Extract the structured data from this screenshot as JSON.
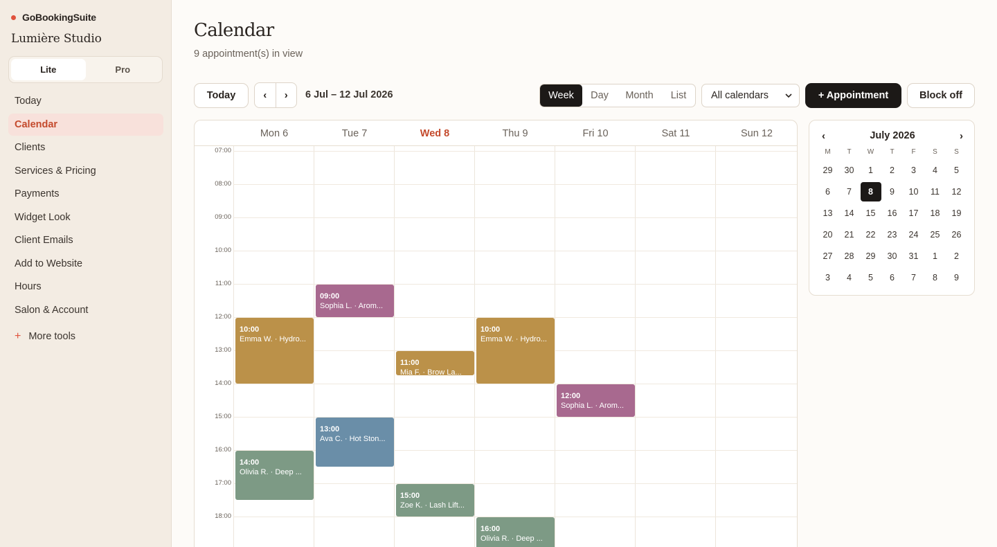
{
  "app": {
    "name": "GoBookingSuite",
    "salon": "Lumière Studio"
  },
  "plan_toggle": {
    "options": [
      "Lite",
      "Pro"
    ],
    "selected": "Lite"
  },
  "sidebar": {
    "items": [
      "Today",
      "Calendar",
      "Clients",
      "Services & Pricing",
      "Payments",
      "Widget Look",
      "Client Emails",
      "Add to Website",
      "Hours",
      "Salon & Account"
    ],
    "active": "Calendar",
    "more": {
      "icon": "+",
      "label": "More tools"
    }
  },
  "header": {
    "title": "Calendar",
    "subtitle": "9 appointment(s) in view"
  },
  "toolbar": {
    "today": "Today",
    "prev": "‹",
    "next": "›",
    "range": "6 Jul – 12 Jul 2026",
    "views": [
      "Week",
      "Day",
      "Month",
      "List"
    ],
    "active_view": "Week",
    "calendar_select": "All calendars",
    "add_appointment": "+ Appointment",
    "block_off": "Block off"
  },
  "week": {
    "days": [
      "Mon 6",
      "Tue 7",
      "Wed 8",
      "Thu 9",
      "Fri 10",
      "Sat 11",
      "Sun 12"
    ],
    "today_index": 2,
    "hours": [
      "07:00",
      "08:00",
      "09:00",
      "10:00",
      "11:00",
      "12:00",
      "13:00",
      "14:00",
      "15:00",
      "16:00",
      "17:00",
      "18:00"
    ]
  },
  "appointments": [
    {
      "day": 1,
      "start": 9,
      "duration": 1,
      "time": "09:00",
      "label": "Sophia L. · Arom...",
      "color": "#a8698f"
    },
    {
      "day": 0,
      "start": 10,
      "duration": 2,
      "time": "10:00",
      "label": "Emma W. · Hydro...",
      "color": "#bb9149"
    },
    {
      "day": 2,
      "start": 11,
      "duration": 0.75,
      "time": "11:00",
      "label": "Mia F. · Brow La...",
      "color": "#bb9149"
    },
    {
      "day": 3,
      "start": 10,
      "duration": 2,
      "time": "10:00",
      "label": "Emma W. · Hydro...",
      "color": "#bb9149"
    },
    {
      "day": 4,
      "start": 12,
      "duration": 1,
      "time": "12:00",
      "label": "Sophia L. · Arom...",
      "color": "#a8698f"
    },
    {
      "day": 1,
      "start": 13,
      "duration": 1.5,
      "time": "13:00",
      "label": "Ava C. · Hot Ston...",
      "color": "#6a8ea8"
    },
    {
      "day": 0,
      "start": 14,
      "duration": 1.5,
      "time": "14:00",
      "label": "Olivia R. · Deep ...",
      "color": "#7d9a85"
    },
    {
      "day": 2,
      "start": 15,
      "duration": 1,
      "time": "15:00",
      "label": "Zoe K. · Lash Lift...",
      "color": "#7d9a85"
    },
    {
      "day": 3,
      "start": 16,
      "duration": 1.5,
      "time": "16:00",
      "label": "Olivia R. · Deep ...",
      "color": "#7d9a85"
    }
  ],
  "mini_calendar": {
    "title": "July 2026",
    "prev": "‹",
    "next": "›",
    "weekdays": [
      "M",
      "T",
      "W",
      "T",
      "F",
      "S",
      "S"
    ],
    "weeks": [
      [
        "29",
        "30",
        "1",
        "2",
        "3",
        "4",
        "5"
      ],
      [
        "6",
        "7",
        "8",
        "9",
        "10",
        "11",
        "12"
      ],
      [
        "13",
        "14",
        "15",
        "16",
        "17",
        "18",
        "19"
      ],
      [
        "20",
        "21",
        "22",
        "23",
        "24",
        "25",
        "26"
      ],
      [
        "27",
        "28",
        "29",
        "30",
        "31",
        "1",
        "2"
      ],
      [
        "3",
        "4",
        "5",
        "6",
        "7",
        "8",
        "9"
      ]
    ],
    "selected_week": 1,
    "selected_day": 2
  },
  "colors": {
    "accent": "#c44a2c",
    "dark": "#1c1917",
    "brand_dot": "#e0523d"
  }
}
